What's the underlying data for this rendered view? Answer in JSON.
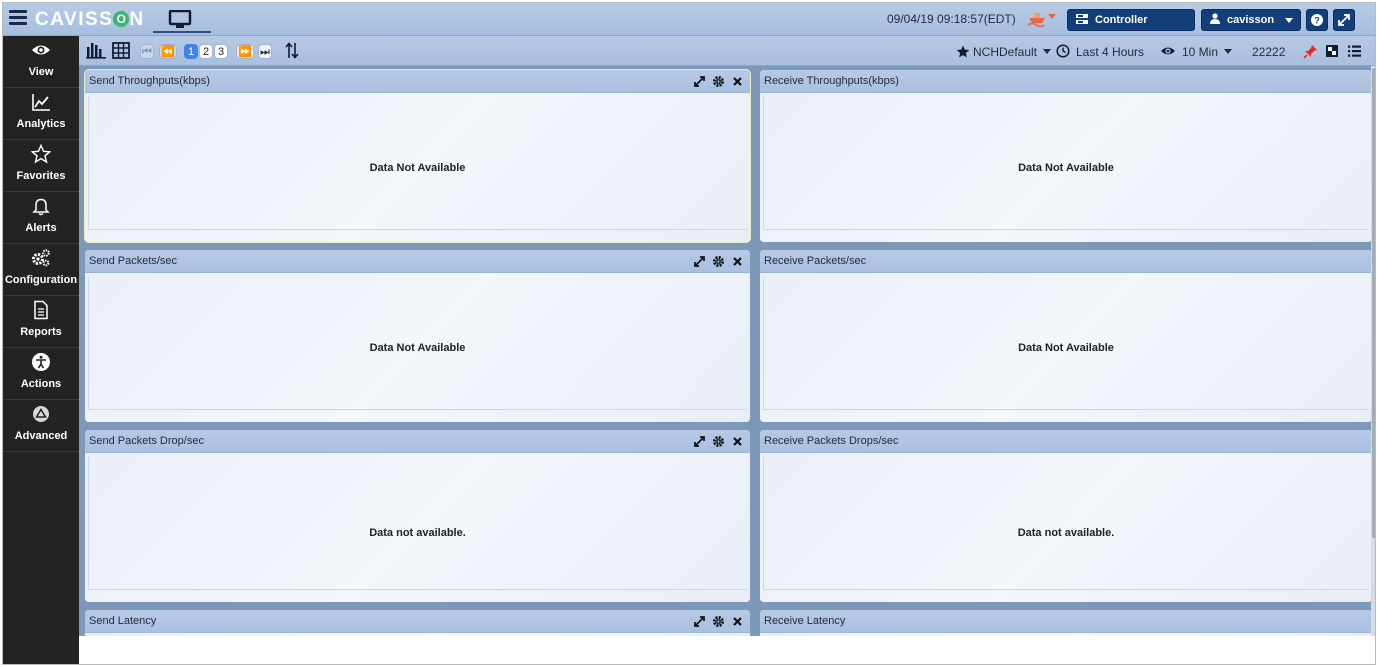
{
  "header": {
    "logo_left": "CAVISS",
    "logo_o": "O",
    "logo_right": "N",
    "datetime": "09/04/19 09:18:57(EDT)",
    "controller_label": "Controller",
    "user_label": "cavisson",
    "help_symbol": "?",
    "icons": [
      "hamburger-icon",
      "monitor-icon",
      "ship-icon",
      "server-icon",
      "user-icon",
      "help-icon",
      "expand-icon"
    ]
  },
  "sidebar": {
    "items": [
      {
        "label": "View",
        "icon": "eye-icon"
      },
      {
        "label": "Analytics",
        "icon": "chart-line-icon"
      },
      {
        "label": "Favorites",
        "icon": "star-icon"
      },
      {
        "label": "Alerts",
        "icon": "bell-icon"
      },
      {
        "label": "Configuration",
        "icon": "gears-icon"
      },
      {
        "label": "Reports",
        "icon": "document-icon"
      },
      {
        "label": "Actions",
        "icon": "accessibility-icon"
      },
      {
        "label": "Advanced",
        "icon": "advanced-icon"
      }
    ]
  },
  "toolbar": {
    "pages": [
      "1",
      "2",
      "3"
    ],
    "current_page": "1",
    "favorite_label": "NCHDefault",
    "time_range": "Last 4 Hours",
    "interval": "10 Min",
    "count": "22222"
  },
  "panels": [
    {
      "title": "Send Throughputs(kbps)",
      "message": "Data Not Available"
    },
    {
      "title": "Receive Throughputs(kbps)",
      "message": "Data Not Available"
    },
    {
      "title": "Send Packets/sec",
      "message": "Data Not Available"
    },
    {
      "title": "Receive Packets/sec",
      "message": "Data Not Available"
    },
    {
      "title": "Send Packets Drop/sec",
      "message": "Data not available."
    },
    {
      "title": "Receive Packets Drops/sec",
      "message": "Data not available."
    },
    {
      "title": "Send Latency",
      "message": ""
    },
    {
      "title": "Receive Latency",
      "message": ""
    }
  ],
  "colors": {
    "header_bg": "#a6bedf",
    "sidebar_bg": "#232323",
    "button_dark": "#123f79",
    "dashboard_bg": "#7e98ba",
    "page_current": "#3f86e4"
  }
}
